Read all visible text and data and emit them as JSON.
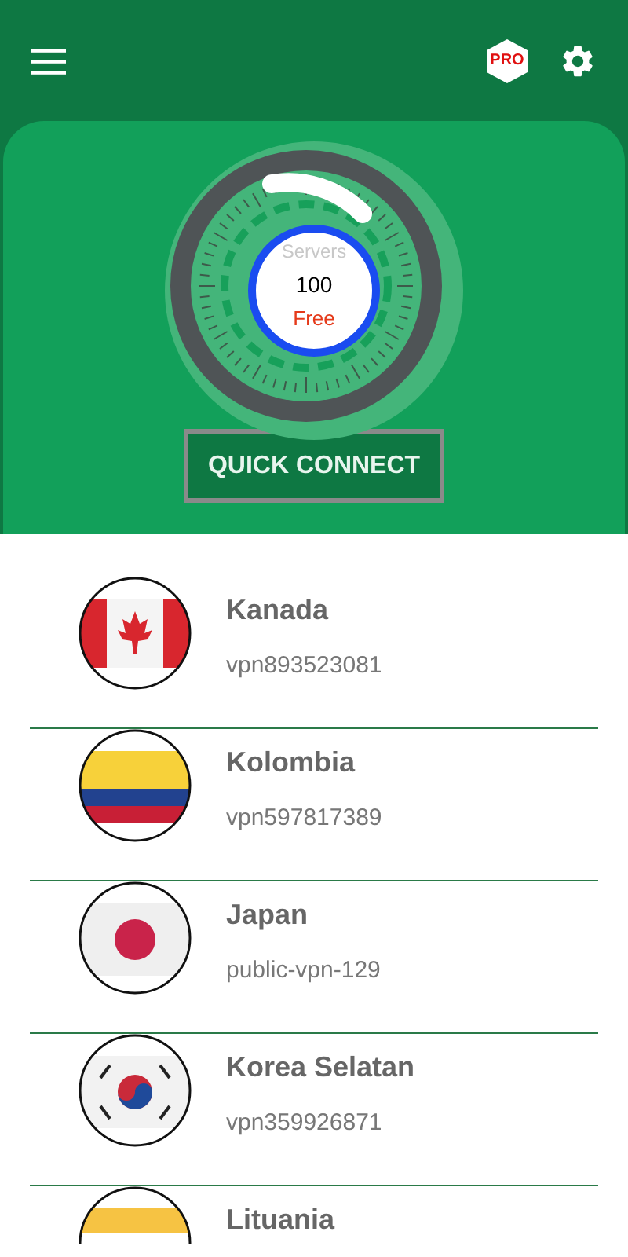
{
  "header": {
    "badge": "PRO"
  },
  "gauge": {
    "label": "Servers",
    "count": "100",
    "plan": "Free"
  },
  "connect_button": "QUICK CONNECT",
  "servers": [
    {
      "kind": "canada",
      "country": "Kanada",
      "host": "vpn893523081"
    },
    {
      "kind": "colombia",
      "country": "Kolombia",
      "host": "vpn597817389"
    },
    {
      "kind": "japan",
      "country": "Japan",
      "host": "public-vpn-129"
    },
    {
      "kind": "korea",
      "country": "Korea Selatan",
      "host": "vpn359926871"
    },
    {
      "kind": "lithuania",
      "country": "Lituania"
    }
  ]
}
